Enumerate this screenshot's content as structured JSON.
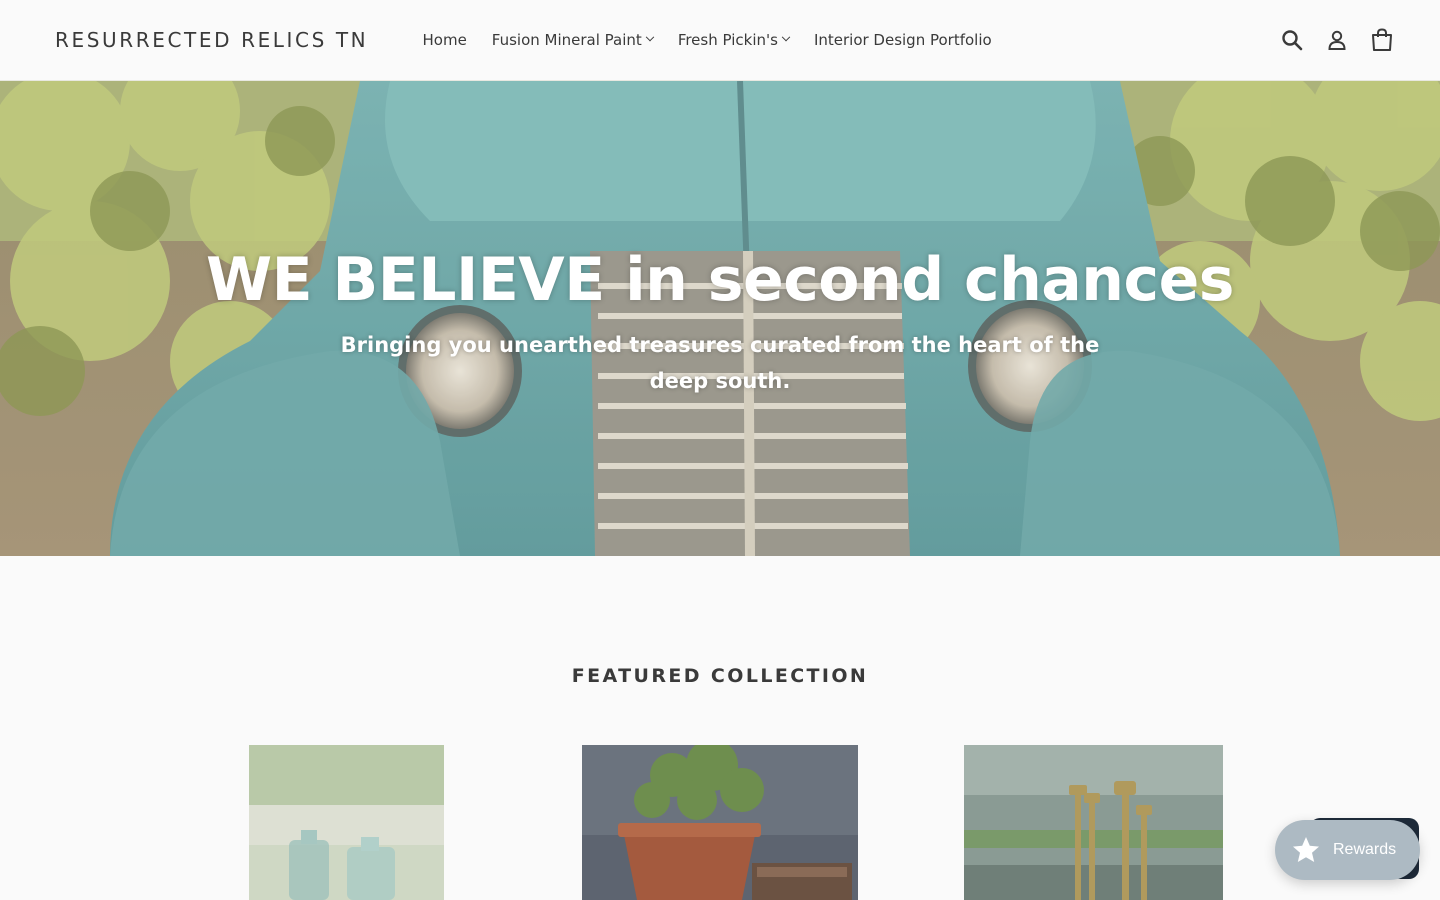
{
  "header": {
    "logo": "RESURRECTED RELICS TN",
    "nav": [
      {
        "label": "Home",
        "dropdown": false
      },
      {
        "label": "Fusion Mineral Paint",
        "dropdown": true
      },
      {
        "label": "Fresh Pickin's",
        "dropdown": true
      },
      {
        "label": "Interior Design Portfolio",
        "dropdown": false
      }
    ],
    "icons": [
      "search-icon",
      "account-icon",
      "cart-icon"
    ]
  },
  "hero": {
    "title": "WE BELIEVE in second chances",
    "subtitle": "Bringing you unearthed treasures curated from the heart of the deep south."
  },
  "featured": {
    "title": "FEATURED COLLECTION",
    "products": [
      "glass-bottles-image",
      "potted-plant-image",
      "brass-candlesticks-image"
    ]
  },
  "rewards": {
    "label": "Rewards"
  },
  "colors": {
    "background": "#fafafa",
    "text": "#3a3a3a",
    "rewards": "#adbac3",
    "truck_teal": "#5fa3a4"
  }
}
